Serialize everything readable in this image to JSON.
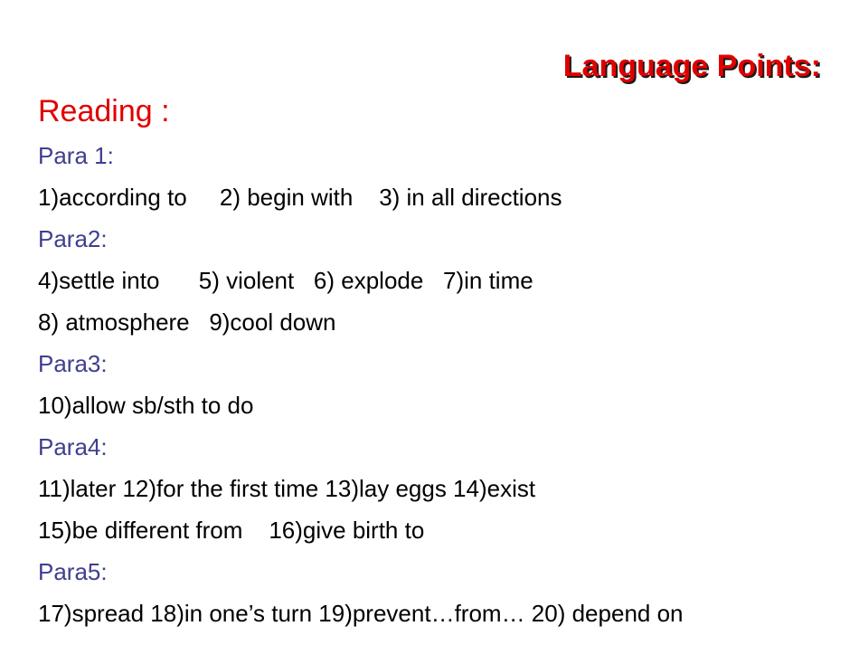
{
  "slide": {
    "title": "Language Points:",
    "title_color": "#e00000",
    "title_shadow_color": "#1a1a1a",
    "background_color": "#ffffff"
  },
  "content": {
    "reading_heading": "Reading :",
    "reading_heading_color": "#e00000",
    "para_heading_color": "#3f3f8f",
    "body_text_color": "#000000",
    "sections": [
      {
        "heading": "Para 1:",
        "lines": [
          "1)according to     2) begin with    3) in all directions"
        ]
      },
      {
        "heading": "Para2:",
        "lines": [
          "4)settle into      5) violent   6) explode   7)in time",
          "8) atmosphere   9)cool down"
        ]
      },
      {
        "heading": "Para3:",
        "lines": [
          "10)allow sb/sth to do"
        ]
      },
      {
        "heading": "Para4:",
        "lines": [
          "11)later 12)for the first time 13)lay eggs 14)exist",
          "15)be different from    16)give birth to"
        ]
      },
      {
        "heading": "Para5:",
        "lines": [
          "17)spread 18)in one’s turn 19)prevent…from… 20) depend on"
        ]
      }
    ]
  }
}
